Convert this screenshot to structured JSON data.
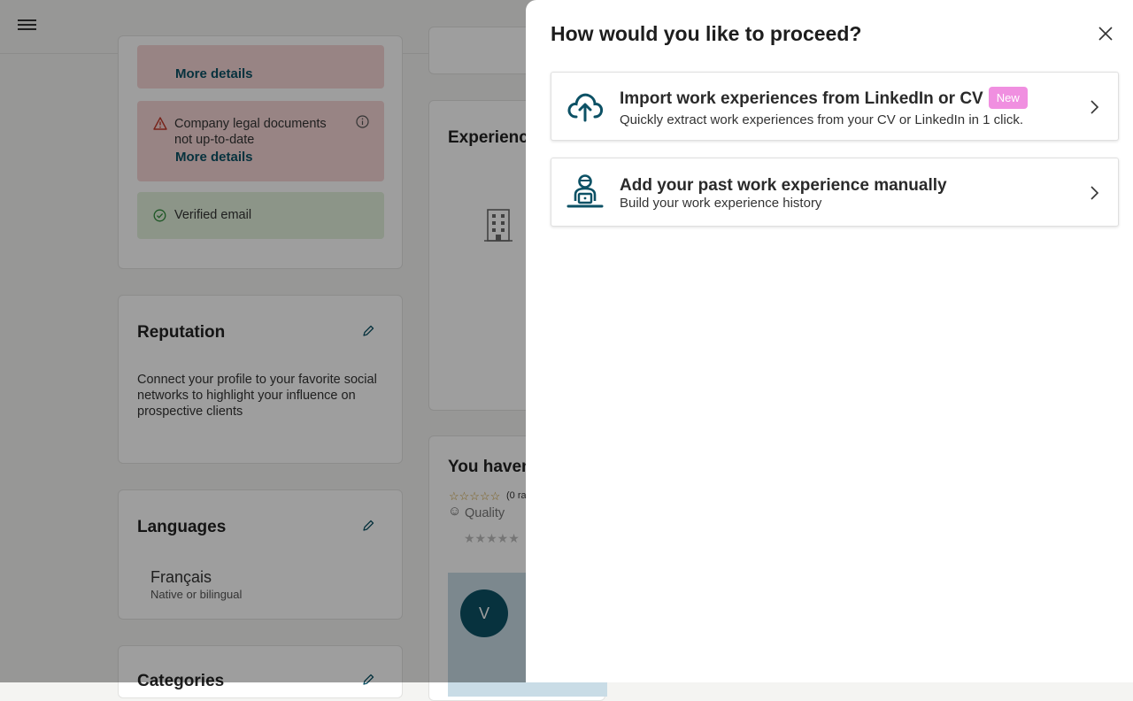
{
  "sidebar": {
    "alert1_link": "More details",
    "alert2_text": "Company legal documents not up-to-date",
    "alert2_link": "More details",
    "verified_text": "Verified email"
  },
  "reputation": {
    "title": "Reputation",
    "text": "Connect your profile to your favorite social networks to highlight your influence on prospective clients"
  },
  "languages": {
    "title": "Languages",
    "language": "Français",
    "level": "Native or bilingual"
  },
  "categories": {
    "title": "Categories"
  },
  "experience": {
    "title": "Experience"
  },
  "reviews": {
    "title": "You haven'",
    "rating_count": "(0 ra",
    "quality_label": "Quality",
    "avatar_letter": "V"
  },
  "modal": {
    "title": "How would you like to proceed?",
    "options": [
      {
        "title": "Import work experiences from LinkedIn or CV",
        "badge": "New",
        "description": "Quickly extract work experiences from your CV or LinkedIn in 1 click."
      },
      {
        "title": "Add your past work experience manually",
        "description": "Build your work experience history"
      }
    ]
  },
  "colors": {
    "accent": "#0c5165",
    "badge": "#f08fe0",
    "alert_red": "#f6d6d6",
    "alert_green": "#e2f1db"
  }
}
